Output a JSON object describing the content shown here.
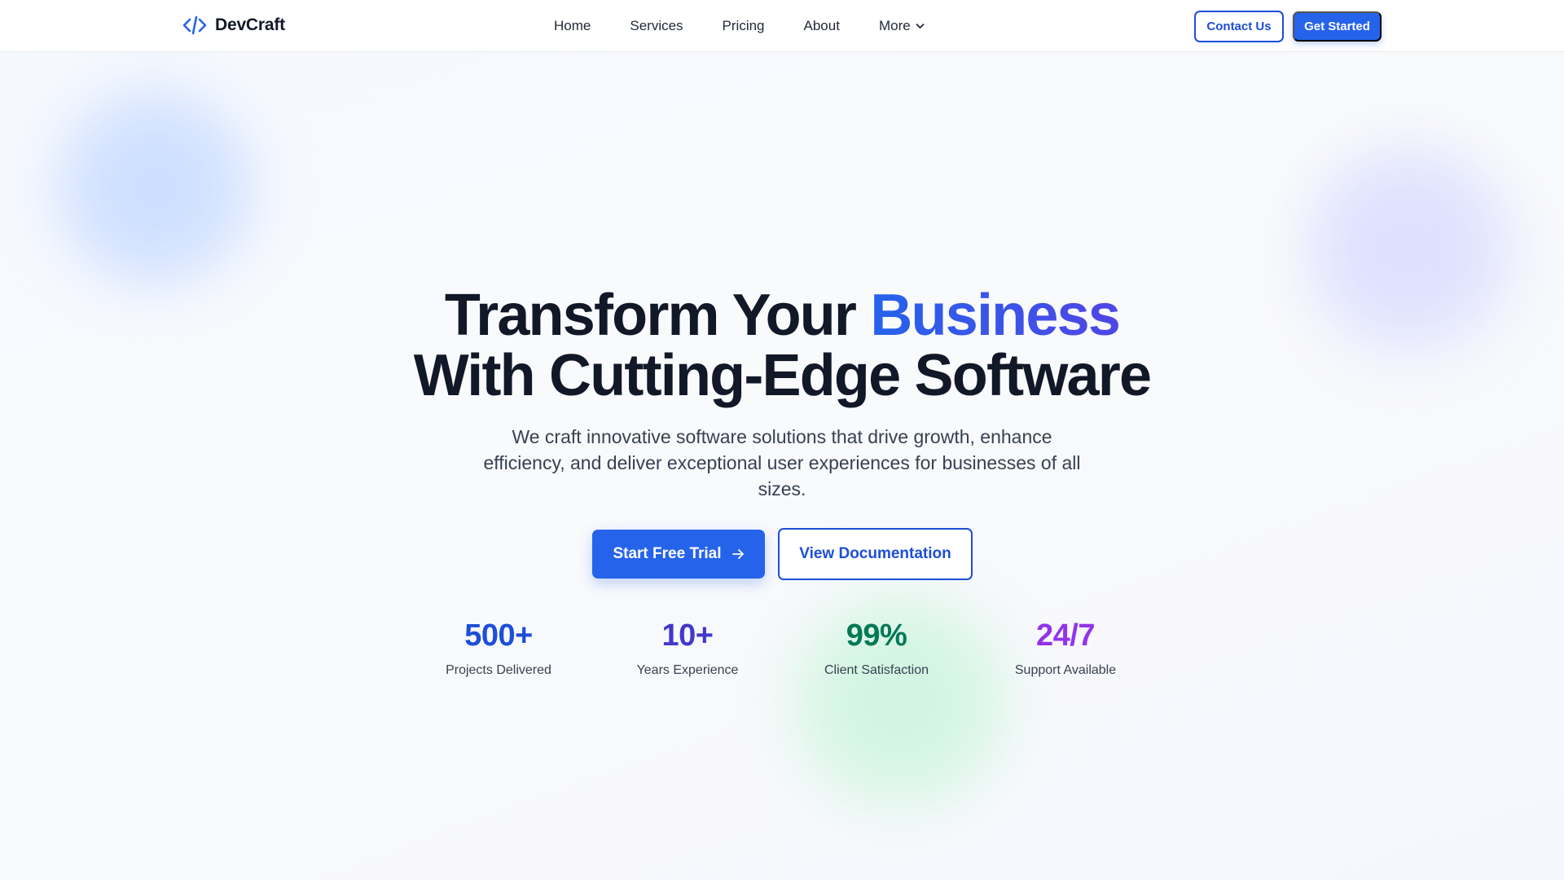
{
  "brand": {
    "name": "DevCraft",
    "icon": "code-brackets-icon",
    "color": "#2563eb"
  },
  "nav": {
    "links": [
      "Home",
      "Services",
      "Pricing",
      "About",
      "More"
    ],
    "more_icon": "chevron-down-icon",
    "contact_label": "Contact Us",
    "get_started_label": "Get Started"
  },
  "hero": {
    "headline_part1": "Transform Your ",
    "headline_accent": "Business",
    "headline_part2": "With Cutting-Edge Software",
    "subtitle": "We craft innovative software solutions that drive growth, enhance efficiency, and deliver exceptional user experiences for businesses of all sizes.",
    "primary_cta": "Start Free Trial",
    "primary_cta_icon": "arrow-right-icon",
    "secondary_cta": "View Documentation"
  },
  "stats": [
    {
      "value": "500+",
      "label": "Projects Delivered",
      "color": "#1d4ed8"
    },
    {
      "value": "10+",
      "label": "Years Experience",
      "color": "#4338ca"
    },
    {
      "value": "99%",
      "label": "Client Satisfaction",
      "color": "#047857"
    },
    {
      "value": "24/7",
      "label": "Support Available",
      "color": "#9333ea"
    }
  ],
  "colors": {
    "primary": "#2563eb",
    "accent_gradient_end": "#4f46e5",
    "text_dark": "#111827"
  }
}
